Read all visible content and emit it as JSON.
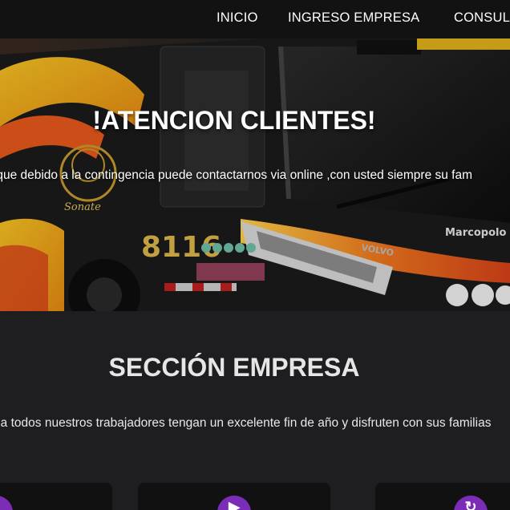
{
  "nav": {
    "items": [
      {
        "label": "INICIO"
      },
      {
        "label": "INGRESO EMPRESA"
      },
      {
        "label": "CONSUL"
      }
    ]
  },
  "hero": {
    "title": "!ATENCION CLIENTES!",
    "text": "erde que debido a la contingencia puede contactarnos via online ,con usted siempre su fam",
    "image": {
      "bus_number": "8116",
      "brand": "Marcopolo",
      "logo_text": "Sonate",
      "maker": "VOLVO"
    }
  },
  "section": {
    "title": "SECCIÓN EMPRESA",
    "text": "os a todos nuestros trabajadores tengan un excelente fin de año y disfruten con sus familias"
  },
  "cards": [
    {
      "icon": "user-icon"
    },
    {
      "icon": "bus-icon"
    },
    {
      "icon": "refresh-icon"
    }
  ],
  "colors": {
    "nav_bg": "#121212",
    "page_bg": "#1e1d1f",
    "accent": "#7b2db8",
    "bus_yellow": "#f2b318",
    "bus_orange": "#e8591c"
  }
}
